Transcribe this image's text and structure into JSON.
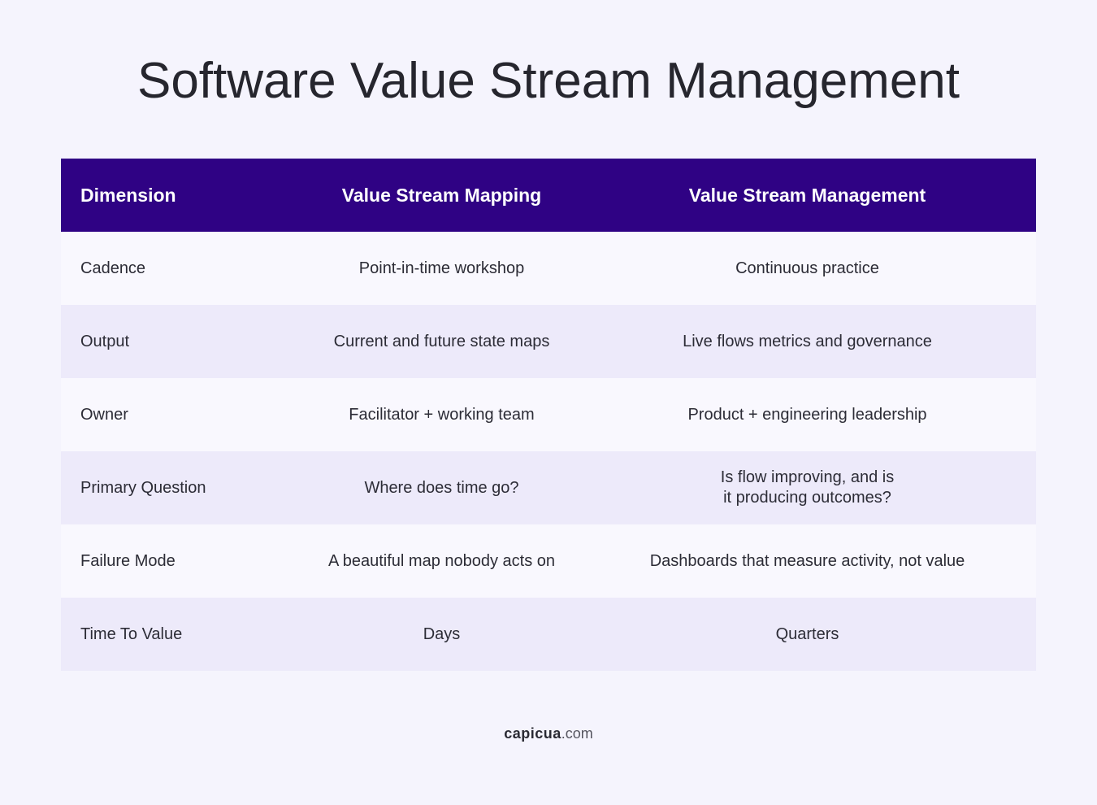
{
  "page": {
    "title": "Software Value Stream Management"
  },
  "table": {
    "headers": [
      "Dimension",
      "Value Stream Mapping",
      "Value Stream Management"
    ],
    "rows": [
      [
        "Cadence",
        "Point-in-time workshop",
        "Continuous practice"
      ],
      [
        "Output",
        "Current and future state maps",
        "Live flows metrics and governance"
      ],
      [
        "Owner",
        "Facilitator + working team",
        "Product + engineering leadership"
      ],
      [
        "Primary Question",
        "Where does time go?",
        "Is flow improving, and is\nit producing outcomes?"
      ],
      [
        "Failure Mode",
        "A beautiful map nobody acts on",
        "Dashboards that measure activity, not value"
      ],
      [
        "Time To Value",
        "Days",
        "Quarters"
      ]
    ]
  },
  "footer": {
    "brand": "capicua",
    "domain": ".com"
  },
  "colors": {
    "header_bg": "#2f0284",
    "page_bg": "#f5f4fd",
    "row_light": "#f9f8fe",
    "row_shaded": "#edeafa"
  }
}
